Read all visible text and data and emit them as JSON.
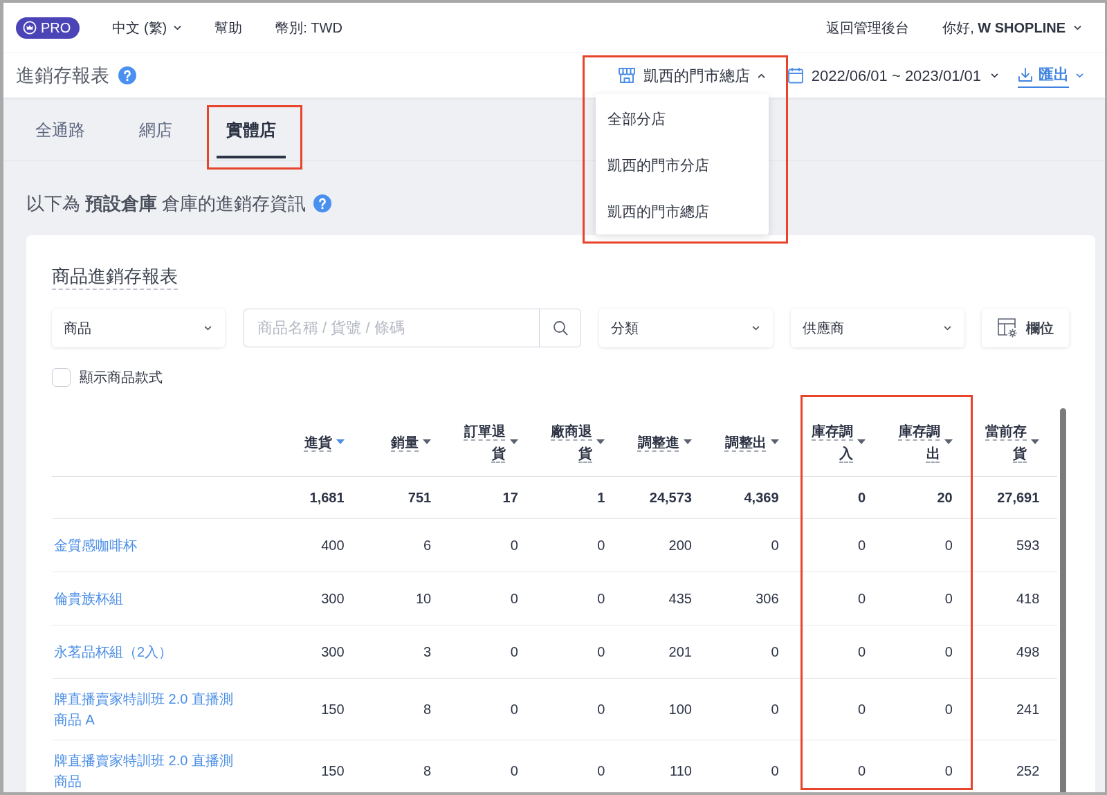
{
  "top_nav": {
    "badge": "PRO",
    "links": [
      {
        "kind": "dropdown",
        "label": "中文 (繁)"
      },
      {
        "kind": "link",
        "label": "幫助"
      },
      {
        "kind": "text",
        "label": "幣別: TWD"
      }
    ],
    "back_link": "返回管理後台",
    "greeting": "你好, **W SHOPLINE**"
  },
  "page_header": {
    "title": "進銷存報表",
    "store_select": {
      "value": "凱西的門市總店",
      "expanded": true,
      "highlighted": true,
      "options": [
        "全部分店",
        "凱西的門市分店",
        "凱西的門市總店"
      ]
    },
    "date_range": "2022/06/01 ~ 2023/01/01",
    "export": "匯出"
  },
  "tabs": [
    {
      "label": "全通路",
      "selected": false,
      "highlighted": false
    },
    {
      "label": "網店",
      "selected": false,
      "highlighted": false
    },
    {
      "label": "實體店",
      "selected": true,
      "highlighted": true
    }
  ],
  "info": "以下為 **預設倉庫** 倉庫的進銷存資訊",
  "report": {
    "title": "商品進銷存報表",
    "type_select": "商品",
    "search": {
      "placeholder": "商品名稱 / 貨號 / 條碼"
    },
    "category_select": "分類",
    "supplier_select": "供應商",
    "columns_button": "欄位",
    "show_variants": {
      "label": "顯示商品款式",
      "checked": false
    },
    "table": {
      "columns": [
        {
          "label": "進貨",
          "sorted": true,
          "highlighted": false
        },
        {
          "label": "銷量",
          "sorted": false,
          "highlighted": false
        },
        {
          "label": "訂單退貨",
          "sorted": false,
          "highlighted": false
        },
        {
          "label": "廠商退貨",
          "sorted": false,
          "highlighted": false
        },
        {
          "label": "調整進",
          "sorted": false,
          "highlighted": false
        },
        {
          "label": "調整出",
          "sorted": false,
          "highlighted": false
        },
        {
          "label": "庫存調入",
          "sorted": false,
          "highlighted": true
        },
        {
          "label": "庫存調出",
          "sorted": false,
          "highlighted": true
        },
        {
          "label": "當前存貨",
          "sorted": false,
          "highlighted": false
        }
      ],
      "total_row": [
        "1,681",
        "751",
        "17",
        "1",
        "24,573",
        "4,369",
        "0",
        "20",
        "27,691"
      ],
      "rows": [
        {
          "name": [
            "金質感咖啡杯"
          ],
          "values": [
            "400",
            "6",
            "0",
            "0",
            "200",
            "0",
            "0",
            "0",
            "593"
          ]
        },
        {
          "name": [
            "倫貴族杯組"
          ],
          "values": [
            "300",
            "10",
            "0",
            "0",
            "435",
            "306",
            "0",
            "0",
            "418"
          ]
        },
        {
          "name": [
            "永茗品杯組（2入）"
          ],
          "values": [
            "300",
            "3",
            "0",
            "0",
            "201",
            "0",
            "0",
            "0",
            "498"
          ]
        },
        {
          "name": [
            "牌直播賣家特訓班 2.0 直播測",
            "商品 A"
          ],
          "values": [
            "150",
            "8",
            "0",
            "0",
            "100",
            "0",
            "0",
            "0",
            "241"
          ]
        },
        {
          "name": [
            "牌直播賣家特訓班 2.0 直播測",
            "商品"
          ],
          "values": [
            "150",
            "8",
            "0",
            "0",
            "110",
            "0",
            "0",
            "0",
            "252"
          ]
        }
      ]
    }
  }
}
